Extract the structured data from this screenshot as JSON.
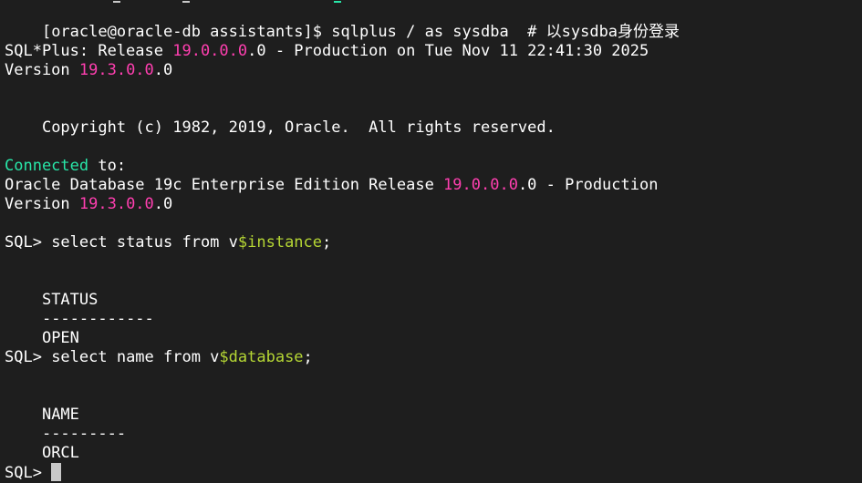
{
  "terminal": {
    "prompt_line": "[oracle@oracle-db assistants]$ sqlplus / as sysdba  # 以sysdba身份登录",
    "banner": {
      "product_prefix": "SQL*Plus: Release ",
      "product_version_hl": "19.0.0.0",
      "product_version_tail": ".0 - Production on Tue Nov 11 22:41:30 2025",
      "version_label": "Version ",
      "version_hl": "19.3.0.0",
      "version_tail": ".0"
    },
    "copyright": "Copyright (c) 1982, 2019, Oracle.  All rights reserved.",
    "connected": {
      "word": "Connected",
      "rest": " to:",
      "db_prefix": "Oracle Database 19c Enterprise Edition Release ",
      "db_version_hl": "19.0.0.0",
      "db_version_tail": ".0 - Production",
      "version_label": "Version ",
      "version_hl": "19.3.0.0",
      "version_tail": ".0"
    },
    "query1": {
      "prompt": "SQL> ",
      "cmd_prefix": "select status from v",
      "cmd_hl": "$instance",
      "cmd_tail": ";",
      "column": "STATUS",
      "divider": "------------",
      "value": "OPEN"
    },
    "query2": {
      "prompt": "SQL> ",
      "cmd_prefix": "select name from v",
      "cmd_hl": "$database",
      "cmd_tail": ";",
      "column": "NAME",
      "divider": "---------",
      "value": "ORCL"
    },
    "final_prompt": "SQL> "
  }
}
